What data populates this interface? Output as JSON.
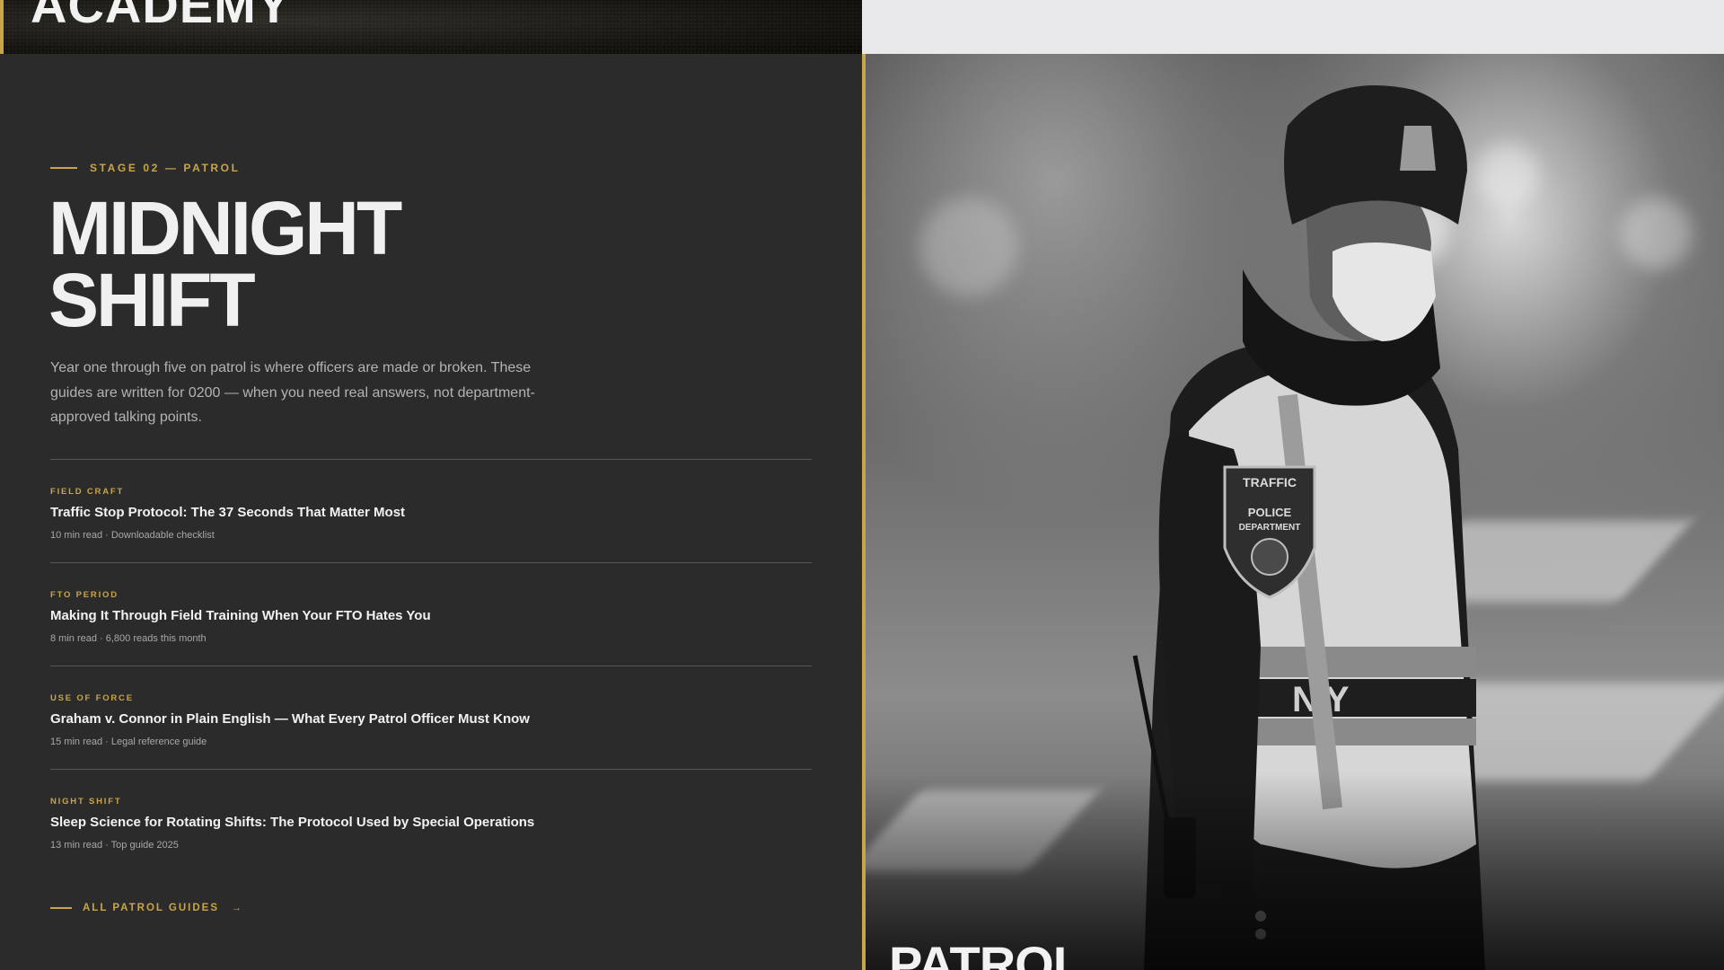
{
  "header": {
    "brand_text": "ACADEMY"
  },
  "section": {
    "eyebrow": "STAGE 02 — PATROL",
    "title_line1": "MIDNIGHT",
    "title_line2": "SHIFT",
    "intro": "Year one through five on patrol is where officers are made or broken. These guides are written for 0200 — when you need real answers, not department-approved talking points."
  },
  "guides": [
    {
      "category": "FIELD CRAFT",
      "title": "Traffic Stop Protocol: The 37 Seconds That Matter Most",
      "meta": "10 min read · Downloadable checklist"
    },
    {
      "category": "FTO PERIOD",
      "title": "Making It Through Field Training When Your FTO Hates You",
      "meta": "8 min read · 6,800 reads this month"
    },
    {
      "category": "USE OF FORCE",
      "title": "Graham v. Connor in Plain English — What Every Patrol Officer Must Know",
      "meta": "15 min read · Legal reference guide"
    },
    {
      "category": "NIGHT SHIFT",
      "title": "Sleep Science for Rotating Shifts: The Protocol Used by Special Operations",
      "meta": "13 min read · Top guide 2025"
    }
  ],
  "cta": {
    "label": "ALL PATROL GUIDES",
    "arrow": "→"
  },
  "photo": {
    "patch_top": "TRAFFIC",
    "patch_line1": "POLICE",
    "patch_line2": "DEPARTMENT",
    "vest_text": "NY",
    "caption": "PATROL"
  },
  "colors": {
    "accent": "#c9a54a",
    "panel_bg": "#2b2b2b",
    "top_right_bg": "#e9e9ec"
  }
}
